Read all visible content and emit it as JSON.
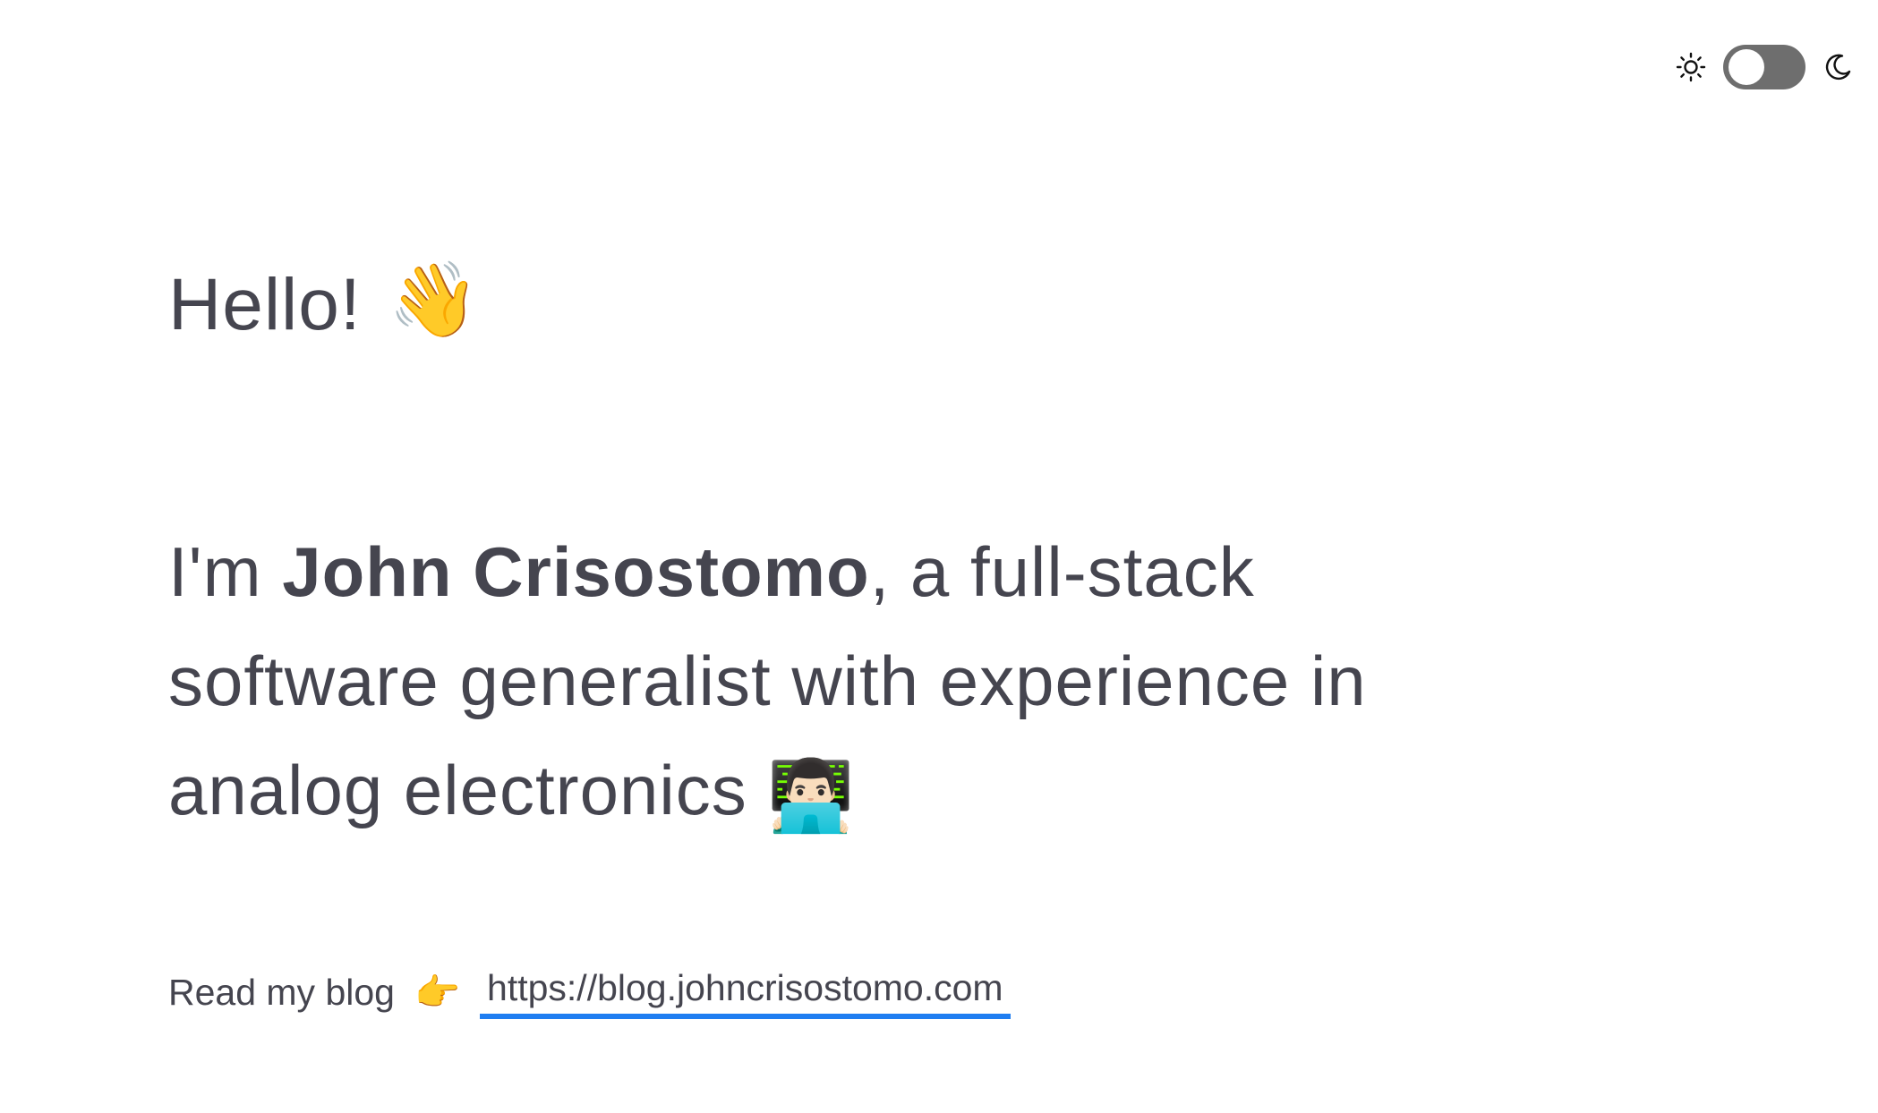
{
  "theme_toggle": {
    "light_icon": "sun-icon",
    "dark_icon": "moon-icon",
    "state": "light",
    "track_color": "#6e6e6e"
  },
  "greeting": {
    "text": "Hello!",
    "emoji": "👋"
  },
  "intro": {
    "prefix": "I'm ",
    "name": "John Crisostomo",
    "suffix": ", a full-stack software generalist with experience in analog electronics",
    "emoji": "👨🏻‍💻"
  },
  "blog": {
    "label": "Read my blog",
    "pointer_emoji": "👉",
    "link_text": "https://blog.johncrisostomo.com",
    "link_underline_color": "#1f7ef1"
  },
  "colors": {
    "text": "#45454f",
    "background": "#ffffff"
  }
}
